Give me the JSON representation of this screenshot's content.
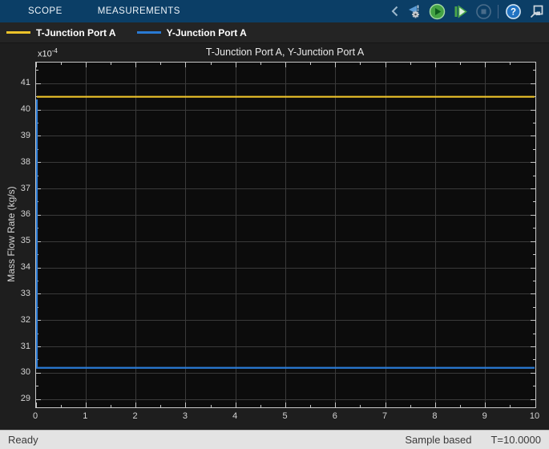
{
  "tabbar": {
    "tabs": [
      {
        "label": "SCOPE"
      },
      {
        "label": "MEASUREMENTS"
      }
    ],
    "toolbar_icons": [
      "collapse-toolstrip",
      "simulation-settings",
      "run",
      "step-forward",
      "stop",
      "help",
      "dock"
    ],
    "help_glyph": "?",
    "colors": {
      "background": "#0b3e66",
      "run_green": "#44a344",
      "disabled_blue_gray": "#7d93a8"
    }
  },
  "legend": {
    "items": [
      {
        "label": "T-Junction Port A",
        "color": "#edc32a"
      },
      {
        "label": "Y-Junction Port A",
        "color": "#2a7ad4"
      }
    ]
  },
  "chart_data": {
    "type": "line",
    "title": "T-Junction Port A, Y-Junction Port A",
    "ylabel": "Mass Flow Rate (kg/s)",
    "y_exponent_prefix": "x10",
    "y_exponent": "-4",
    "xlim": [
      0,
      10
    ],
    "ylim": [
      28.7,
      41.8
    ],
    "xticks": [
      0,
      1,
      2,
      3,
      4,
      5,
      6,
      7,
      8,
      9,
      10
    ],
    "yticks": [
      29,
      30,
      31,
      32,
      33,
      34,
      35,
      36,
      37,
      38,
      39,
      40,
      41
    ],
    "minor_step_x": 0.5,
    "minor_step_y": 0.5,
    "grid": true,
    "legend_position": "top-bar",
    "series": [
      {
        "name": "T-Junction Port A",
        "color": "#edc32a",
        "points": [
          [
            0,
            40.5
          ],
          [
            10,
            40.5
          ]
        ]
      },
      {
        "name": "Y-Junction Port A",
        "color": "#2a7ad4",
        "points": [
          [
            0,
            40.4
          ],
          [
            0,
            30.2
          ],
          [
            10,
            30.2
          ]
        ]
      }
    ],
    "colors": {
      "plot_background": "#0c0c0c",
      "grid": "#3a3a3a",
      "axis": "#c8c8c8"
    }
  },
  "statusbar": {
    "left": "Ready",
    "sample_mode": "Sample based",
    "time": "T=10.0000"
  }
}
